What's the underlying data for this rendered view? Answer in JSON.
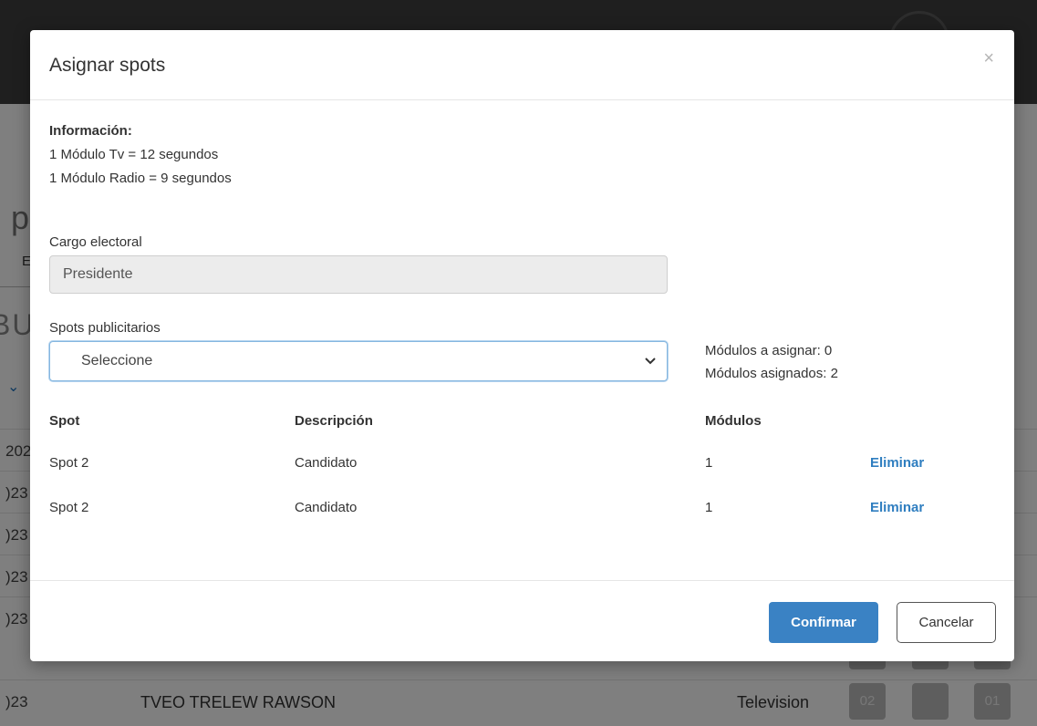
{
  "background": {
    "title_fragment": "ı p",
    "tab_fragment": "E",
    "subtitle_fragment": "BU",
    "row_years": [
      "202",
      ")23",
      ")23",
      ")23",
      ")23"
    ],
    "last_row": {
      "year": ")23",
      "name": "TVEO TRELEW RAWSON",
      "type": "Television",
      "boxes": [
        "02",
        "",
        "01"
      ]
    }
  },
  "modal": {
    "title": "Asignar spots",
    "close_symbol": "×",
    "info": {
      "heading": "Información:",
      "lines": [
        "1 Módulo Tv = 12 segundos",
        "1 Módulo Radio = 9 segundos"
      ]
    },
    "cargo": {
      "label": "Cargo electoral",
      "value": "Presidente"
    },
    "spots": {
      "label": "Spots publicitarios",
      "selected": "Seleccione"
    },
    "modules": {
      "to_assign": "Módulos a asignar: 0",
      "assigned": "Módulos asignados: 2"
    },
    "table": {
      "headers": {
        "spot": "Spot",
        "description": "Descripción",
        "modules": "Módulos"
      },
      "rows": [
        {
          "spot": "Spot 2",
          "description": "Candidato",
          "modules": "1",
          "action": "Eliminar"
        },
        {
          "spot": "Spot 2",
          "description": "Candidato",
          "modules": "1",
          "action": "Eliminar"
        }
      ]
    },
    "footer": {
      "confirm": "Confirmar",
      "cancel": "Cancelar"
    }
  },
  "colors": {
    "primary": "#3a82c4",
    "link": "#2f7ec0",
    "backdrop": "rgba(0,0,0,0.5)"
  }
}
